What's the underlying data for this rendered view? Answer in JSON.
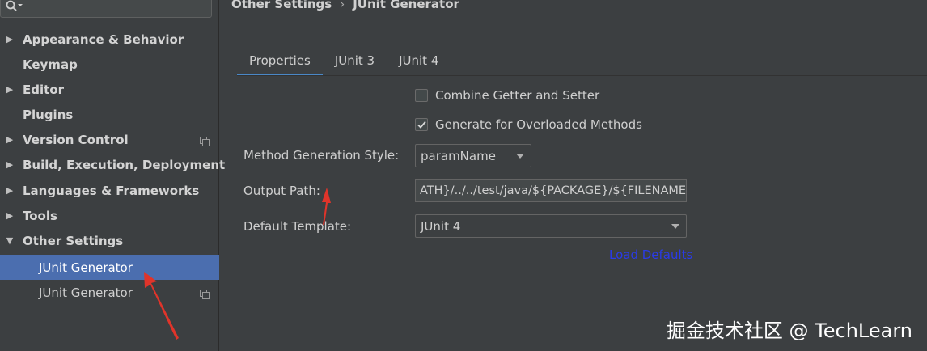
{
  "search": {
    "icon": "search-icon"
  },
  "sidebar": {
    "items": [
      {
        "label": "Appearance & Behavior",
        "arrow": "▶"
      },
      {
        "label": "Keymap",
        "arrow": ""
      },
      {
        "label": "Editor",
        "arrow": "▶"
      },
      {
        "label": "Plugins",
        "arrow": ""
      },
      {
        "label": "Version Control",
        "arrow": "▶"
      },
      {
        "label": "Build, Execution, Deployment",
        "arrow": "▶"
      },
      {
        "label": "Languages & Frameworks",
        "arrow": "▶"
      },
      {
        "label": "Tools",
        "arrow": "▶"
      },
      {
        "label": "Other Settings",
        "arrow": "▼"
      }
    ],
    "children": [
      {
        "label": "JUnit Generator",
        "selected": true
      },
      {
        "label": "JUnit Generator",
        "selected": false
      }
    ]
  },
  "breadcrumb": {
    "parent": "Other Settings",
    "separator": "›",
    "current": "JUnit Generator"
  },
  "tabs": [
    "Properties",
    "JUnit 3",
    "JUnit 4"
  ],
  "form": {
    "combine_getter_setter": {
      "label": "Combine Getter and Setter",
      "checked": false
    },
    "generate_overloaded": {
      "label": "Generate for Overloaded Methods",
      "checked": true
    },
    "method_generation_style": {
      "label": "Method Generation Style:",
      "value": "paramName"
    },
    "output_path": {
      "label": "Output Path:",
      "value": "ATH}/../../test/java/${PACKAGE}/${FILENAME}"
    },
    "default_template": {
      "label": "Default Template:",
      "value": "JUnit 4"
    },
    "load_defaults": "Load Defaults"
  },
  "watermark": "掘金技术社区 @ TechLearn",
  "colors": {
    "selection": "#4b6eaf",
    "accent_tab": "#4a88c7",
    "link": "#2a3be8",
    "annotation_arrow": "#e0342a"
  }
}
